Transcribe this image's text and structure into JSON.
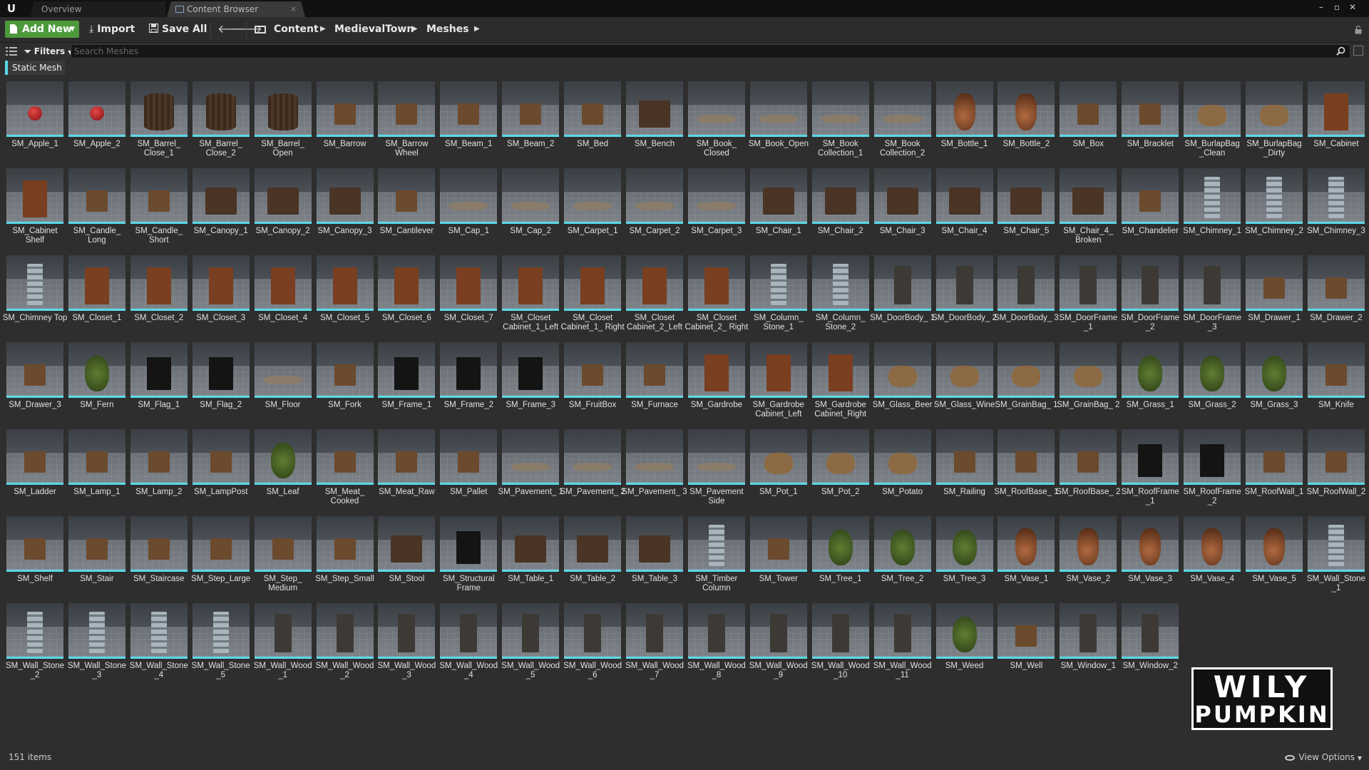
{
  "window": {
    "logo_glyph": "U",
    "tabs": [
      {
        "label": "Overview"
      },
      {
        "label": "Content Browser",
        "close": "×"
      }
    ],
    "controls": [
      "–",
      "▫",
      "✕"
    ]
  },
  "toolbar": {
    "add_new": "Add New",
    "import": "Import",
    "save_all": "Save All",
    "breadcrumb": [
      "Content",
      "MedievalTown",
      "Meshes"
    ]
  },
  "search": {
    "filters_label": "Filters",
    "placeholder": "Search Meshes"
  },
  "filter_chip": "Static Mesh",
  "accent_color": "#5ad9e6",
  "assets": [
    "SM_Apple_1",
    "SM_Apple_2",
    "SM_Barrel_ Close_1",
    "SM_Barrel_ Close_2",
    "SM_Barrel_ Open",
    "SM_Barrow",
    "SM_Barrow Wheel",
    "SM_Beam_1",
    "SM_Beam_2",
    "SM_Bed",
    "SM_Bench",
    "SM_Book_ Closed",
    "SM_Book_Open",
    "SM_Book Collection_1",
    "SM_Book Collection_2",
    "SM_Bottle_1",
    "SM_Bottle_2",
    "SM_Box",
    "SM_Bracklet",
    "SM_BurlapBag _Clean",
    "SM_BurlapBag _Dirty",
    "SM_Cabinet",
    "SM_Cabinet Shelf",
    "SM_Candle_ Long",
    "SM_Candle_ Short",
    "SM_Canopy_1",
    "SM_Canopy_2",
    "SM_Canopy_3",
    "SM_Cantilever",
    "SM_Cap_1",
    "SM_Cap_2",
    "SM_Carpet_1",
    "SM_Carpet_2",
    "SM_Carpet_3",
    "SM_Chair_1",
    "SM_Chair_2",
    "SM_Chair_3",
    "SM_Chair_4",
    "SM_Chair_5",
    "SM_Chair_4_ Broken",
    "SM_Chandelier",
    "SM_Chimney_1",
    "SM_Chimney_2",
    "SM_Chimney_3",
    "SM_Chimney Top",
    "SM_Closet_1",
    "SM_Closet_2",
    "SM_Closet_3",
    "SM_Closet_4",
    "SM_Closet_5",
    "SM_Closet_6",
    "SM_Closet_7",
    "SM_Closet Cabinet_1_Left",
    "SM_Closet Cabinet_1_ Right",
    "SM_Closet Cabinet_2_Left",
    "SM_Closet Cabinet_2_ Right",
    "SM_Column_ Stone_1",
    "SM_Column_ Stone_2",
    "SM_DoorBody_ 1",
    "SM_DoorBody_ 2",
    "SM_DoorBody_ 3",
    "SM_DoorFrame _1",
    "SM_DoorFrame _2",
    "SM_DoorFrame _3",
    "SM_Drawer_1",
    "SM_Drawer_2",
    "SM_Drawer_3",
    "SM_Fern",
    "SM_Flag_1",
    "SM_Flag_2",
    "SM_Floor",
    "SM_Fork",
    "SM_Frame_1",
    "SM_Frame_2",
    "SM_Frame_3",
    "SM_FruitBox",
    "SM_Furnace",
    "SM_Gardrobe",
    "SM_Gardrobe Cabinet_Left",
    "SM_Gardrobe Cabinet_Right",
    "SM_Glass_Beer",
    "SM_Glass_Wine",
    "SM_GrainBag_ 1",
    "SM_GrainBag_ 2",
    "SM_Grass_1",
    "SM_Grass_2",
    "SM_Grass_3",
    "SM_Knife",
    "SM_Ladder",
    "SM_Lamp_1",
    "SM_Lamp_2",
    "SM_LampPost",
    "SM_Leaf",
    "SM_Meat_ Cooked",
    "SM_Meat_Raw",
    "SM_Pallet",
    "SM_Pavement_ 1",
    "SM_Pavement_ 2",
    "SM_Pavement_ 3",
    "SM_Pavement Side",
    "SM_Pot_1",
    "SM_Pot_2",
    "SM_Potato",
    "SM_Railing",
    "SM_RoofBase_ 1",
    "SM_RoofBase_ 2",
    "SM_RoofFrame _1",
    "SM_RoofFrame _2",
    "SM_RoofWall_1",
    "SM_RoofWall_2",
    "SM_Shelf",
    "SM_Stair",
    "SM_Staircase",
    "SM_Step_Large",
    "SM_Step_ Medium",
    "SM_Step_Small",
    "SM_Stool",
    "SM_Structural Frame",
    "SM_Table_1",
    "SM_Table_2",
    "SM_Table_3",
    "SM_Timber Column",
    "SM_Tower",
    "SM_Tree_1",
    "SM_Tree_2",
    "SM_Tree_3",
    "SM_Vase_1",
    "SM_Vase_2",
    "SM_Vase_3",
    "SM_Vase_4",
    "SM_Vase_5",
    "SM_Wall_Stone _1",
    "SM_Wall_Stone _2",
    "SM_Wall_Stone _3",
    "SM_Wall_Stone _4",
    "SM_Wall_Stone _5",
    "SM_Wall_Wood _1",
    "SM_Wall_Wood _2",
    "SM_Wall_Wood _3",
    "SM_Wall_Wood _4",
    "SM_Wall_Wood _5",
    "SM_Wall_Wood _6",
    "SM_Wall_Wood _7",
    "SM_Wall_Wood _8",
    "SM_Wall_Wood _9",
    "SM_Wall_Wood _10",
    "SM_Wall_Wood _11",
    "SM_Weed",
    "SM_Well",
    "SM_Window_1",
    "SM_Window_2"
  ],
  "footer": {
    "item_count": "151 items",
    "view_options": "View Options"
  },
  "logo": {
    "line1": "WILY",
    "line2": "PUMPKIN"
  }
}
